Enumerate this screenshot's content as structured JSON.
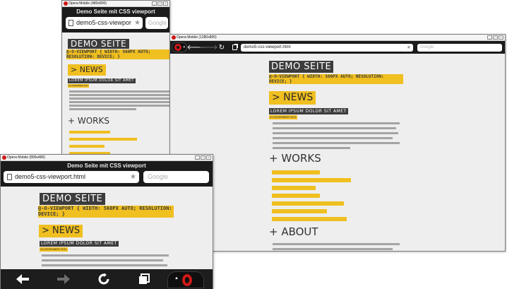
{
  "win_a": {
    "title": "Opera Mobile (480x800)",
    "header": "Demo Seite mit CSS viewport",
    "url": "demo5-css-viewpor",
    "search_placeholder": "Google",
    "page": {
      "site_title": "DEMO SEITE",
      "code": "@-O-VIEWPORT { WIDTH: 560PX AUTO; RESOLUTION: DEVICE; }",
      "news_heading": "> NEWS",
      "article_title": "LOREM IPSUM DOLOR SIT AMET",
      "date": "24 DEZEMBER 2011",
      "works_heading": "+ WORKS"
    }
  },
  "win_b": {
    "title": "Opera Mobile (1280x800)",
    "url": "demo5-css-viewport.html",
    "search_placeholder": "Google",
    "page": {
      "site_title": "DEMO SEITE",
      "code": "@-O-VIEWPORT { WIDTH: 560PX AUTO; RESOLUTION: DEVICE; }",
      "news_heading": "> NEWS",
      "article_title": "LOREM IPSUM DOLOR SIT AMET",
      "date": "24 DEZEMBER 2011",
      "works_heading": "+ WORKS",
      "about_heading": "+ ABOUT"
    }
  },
  "win_c": {
    "title": "Opera Mobile (800x480)",
    "header": "Demo Seite mit CSS viewport",
    "url": "demo5-css-viewport.html",
    "search_placeholder": "Google",
    "page": {
      "site_title": "DEMO SEITE",
      "code": "@-O-VIEWPORT { WIDTH: 560PX AUTO; RESOLUTION: DEVICE; }",
      "news_heading": "> NEWS",
      "article_title": "LOREM IPSUM DOLOR SIT AMET",
      "date": "24 DEZEMBER 2011"
    },
    "toolbar": {
      "opera_menu_arrow": "▲"
    }
  },
  "colors": {
    "accent_yellow": "#f0bf20",
    "dark_label": "#3c3c3c",
    "toolbar_dark": "#1b1b1b",
    "opera_red": "#d01818"
  }
}
